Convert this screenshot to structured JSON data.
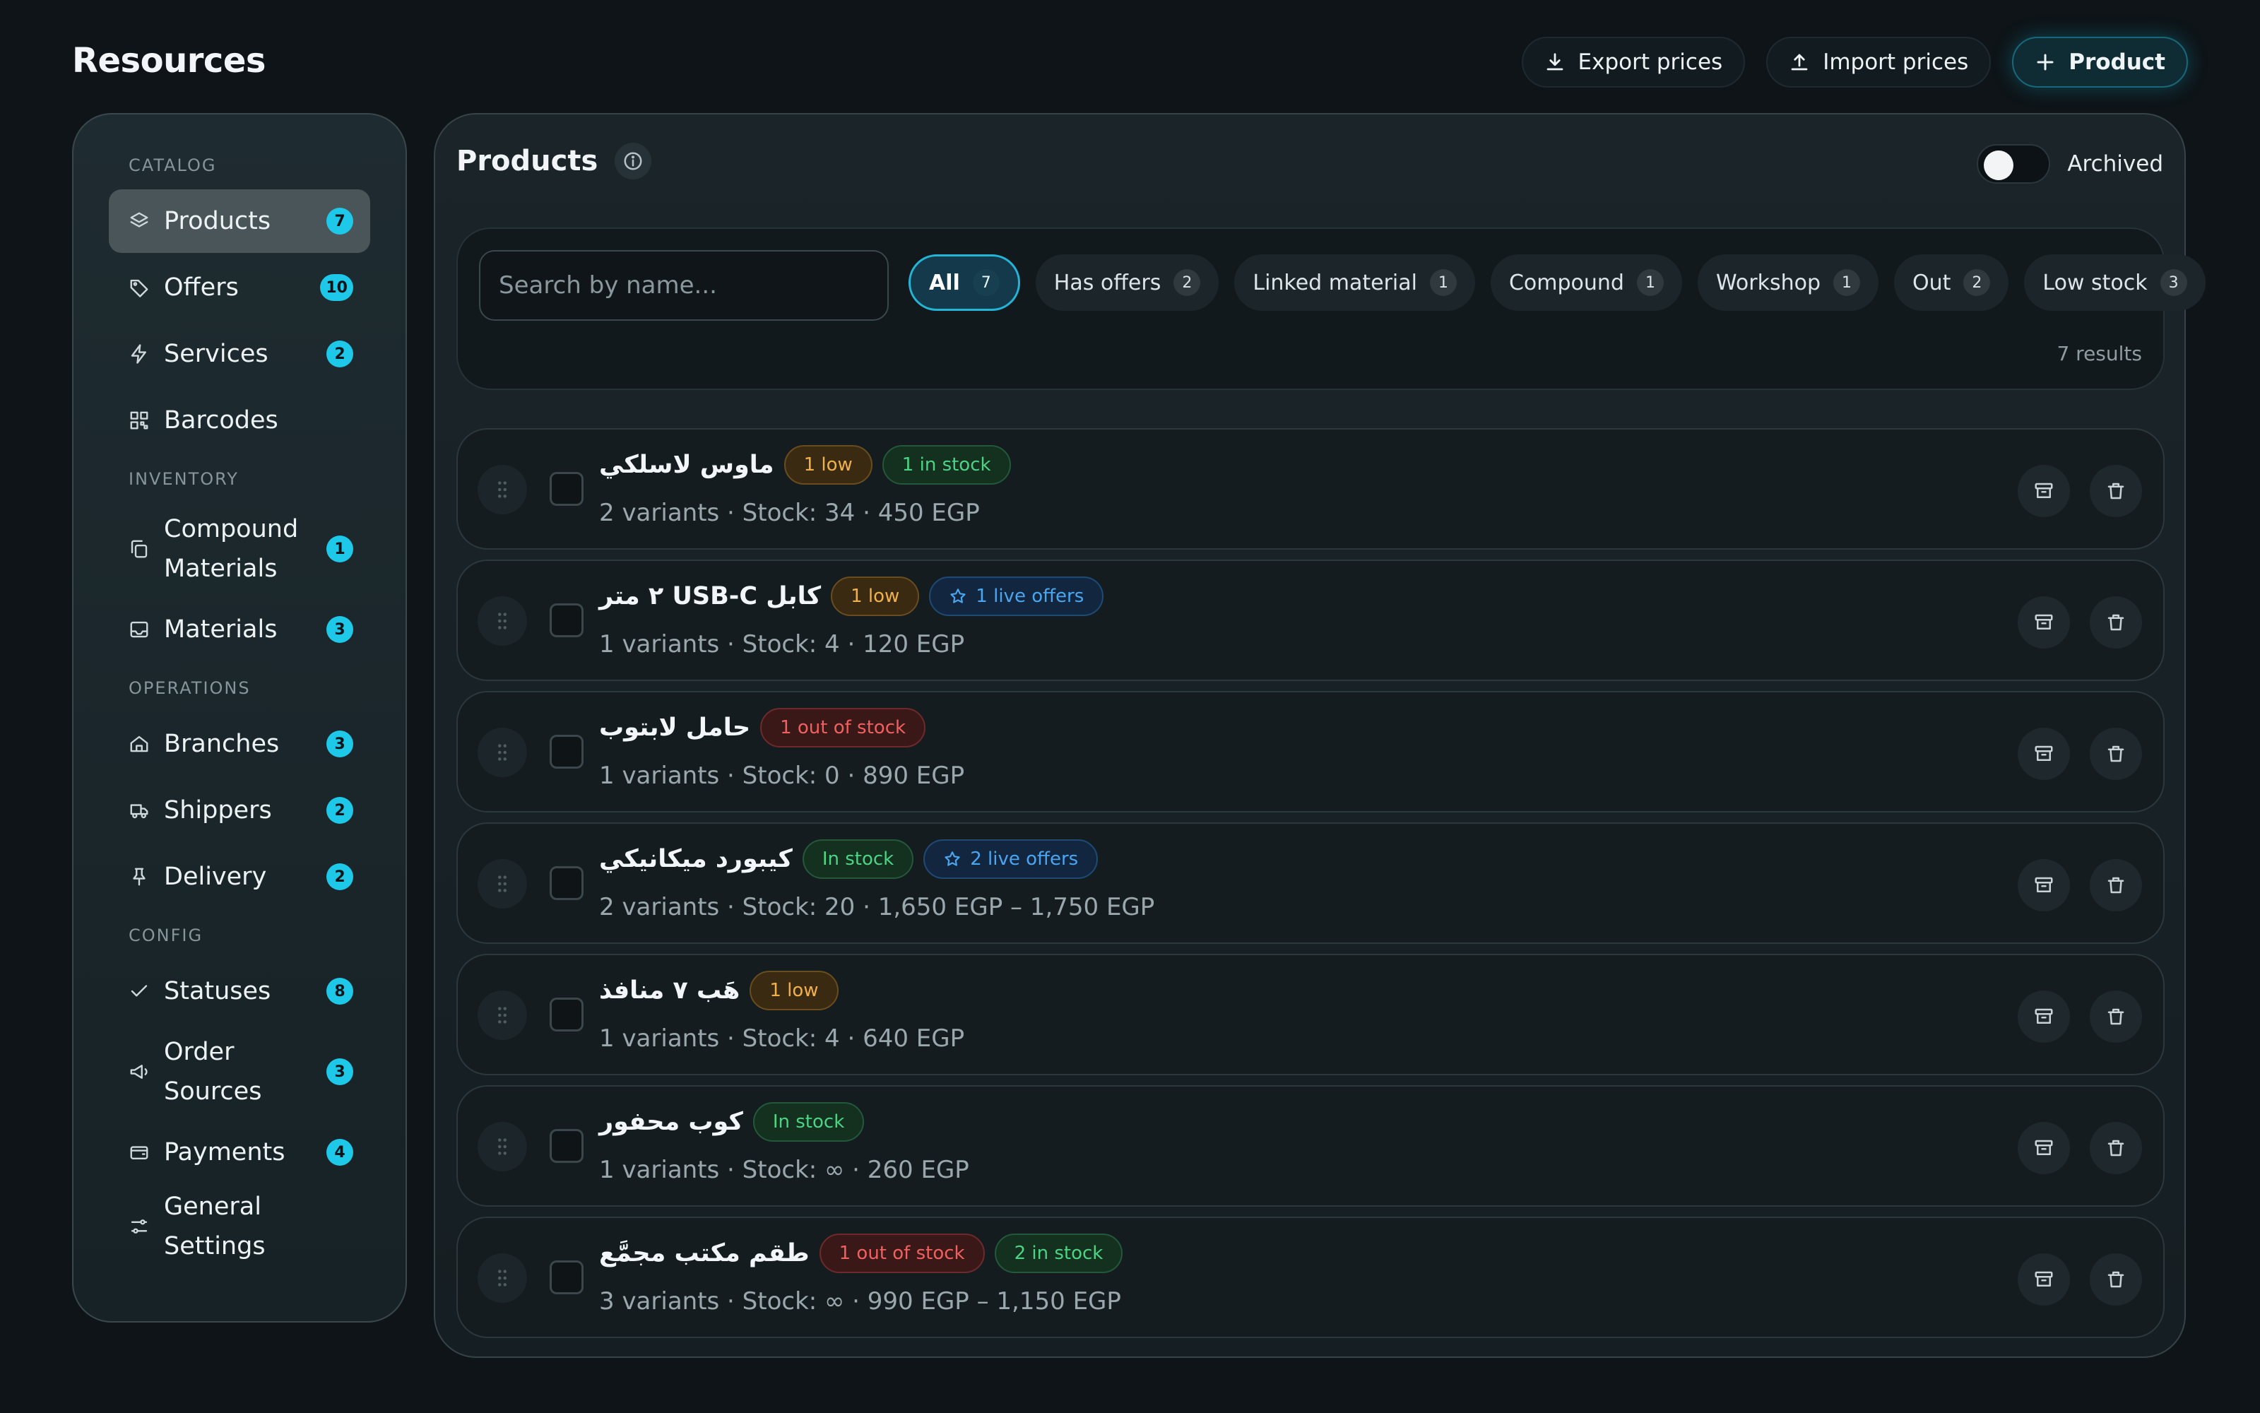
{
  "page": {
    "title": "Resources"
  },
  "top_actions": {
    "export_label": "Export prices",
    "import_label": "Import prices",
    "product_label": "Product"
  },
  "sidebar": {
    "sections": [
      {
        "title": "CATALOG",
        "items": [
          {
            "label": "Products",
            "count": "7",
            "icon": "layers-icon",
            "active": true
          },
          {
            "label": "Offers",
            "count": "10",
            "icon": "tag-icon"
          },
          {
            "label": "Services",
            "count": "2",
            "icon": "bolt-icon"
          },
          {
            "label": "Barcodes",
            "count": "",
            "icon": "barcode-grid-icon"
          }
        ]
      },
      {
        "title": "INVENTORY",
        "items": [
          {
            "label": "Compound Materials",
            "count": "1",
            "icon": "copy-icon"
          },
          {
            "label": "Materials",
            "count": "3",
            "icon": "inbox-icon"
          }
        ]
      },
      {
        "title": "OPERATIONS",
        "items": [
          {
            "label": "Branches",
            "count": "3",
            "icon": "home-icon"
          },
          {
            "label": "Shippers",
            "count": "2",
            "icon": "truck-icon"
          },
          {
            "label": "Delivery",
            "count": "2",
            "icon": "pin-icon"
          }
        ]
      },
      {
        "title": "CONFIG",
        "items": [
          {
            "label": "Statuses",
            "count": "8",
            "icon": "check-icon"
          },
          {
            "label": "Order Sources",
            "count": "3",
            "icon": "megaphone-icon"
          },
          {
            "label": "Payments",
            "count": "4",
            "icon": "wallet-icon"
          },
          {
            "label": "General Settings",
            "count": "",
            "icon": "sliders-icon"
          }
        ]
      }
    ]
  },
  "main": {
    "title": "Products",
    "archived_label": "Archived",
    "archived_on": false,
    "search": {
      "placeholder": "Search by name...",
      "value": ""
    },
    "filters": [
      {
        "label": "All",
        "count": "7",
        "active": true
      },
      {
        "label": "Has offers",
        "count": "2"
      },
      {
        "label": "Linked material",
        "count": "1"
      },
      {
        "label": "Compound",
        "count": "1"
      },
      {
        "label": "Workshop",
        "count": "1"
      },
      {
        "label": "Out",
        "count": "2"
      },
      {
        "label": "Low stock",
        "count": "3"
      }
    ],
    "results_label": "7 results",
    "products": [
      {
        "name": "ماوس لاسلكي",
        "tags": [
          {
            "type": "low",
            "text": "1 low"
          },
          {
            "type": "ok",
            "text": "1 in stock"
          }
        ],
        "sub": "2 variants · Stock: 34 · 450 EGP"
      },
      {
        "name": "كابل USB-C ٢ متر",
        "tags": [
          {
            "type": "low",
            "text": "1 low"
          },
          {
            "type": "offer",
            "text": "1 live offers"
          }
        ],
        "sub": "1 variants · Stock: 4 · 120 EGP"
      },
      {
        "name": "حامل لابتوب",
        "tags": [
          {
            "type": "out",
            "text": "1 out of stock"
          }
        ],
        "sub": "1 variants · Stock: 0 · 890 EGP"
      },
      {
        "name": "كيبورد ميكانيكي",
        "tags": [
          {
            "type": "ok",
            "text": "In stock"
          },
          {
            "type": "offer",
            "text": "2 live offers"
          }
        ],
        "sub": "2 variants · Stock: 20 · 1,650 EGP – 1,750 EGP"
      },
      {
        "name": "هَب ٧ منافذ",
        "tags": [
          {
            "type": "low",
            "text": "1 low"
          }
        ],
        "sub": "1 variants · Stock: 4 · 640 EGP"
      },
      {
        "name": "كوب محفور",
        "tags": [
          {
            "type": "ok",
            "text": "In stock"
          }
        ],
        "sub": "1 variants · Stock: ∞ · 260 EGP"
      },
      {
        "name": "طقم مكتب مجمَّع",
        "tags": [
          {
            "type": "out",
            "text": "1 out of stock"
          },
          {
            "type": "ok",
            "text": "2 in stock"
          }
        ],
        "sub": "3 variants · Stock: ∞ · 990 EGP – 1,150 EGP"
      }
    ]
  }
}
